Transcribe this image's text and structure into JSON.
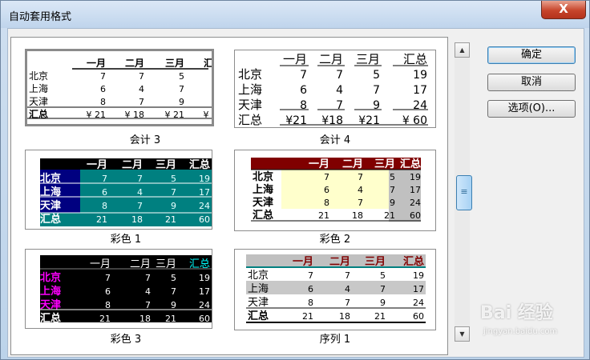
{
  "window": {
    "title": "自动套用格式",
    "close_label": "X"
  },
  "buttons": {
    "ok": "确定",
    "cancel": "取消",
    "options": "选项(O)..."
  },
  "scrollbar": {
    "up": "▲",
    "down": "▼",
    "thumb": "≡"
  },
  "watermark": {
    "brand": "Bai 经验",
    "url": "jingyan.baidu.com"
  },
  "table": {
    "headers": [
      "一月",
      "二月",
      "三月",
      "汇总"
    ],
    "rows": [
      {
        "label": "北京",
        "values": [
          "7",
          "7",
          "5",
          "19"
        ]
      },
      {
        "label": "上海",
        "values": [
          "6",
          "4",
          "7",
          "17"
        ]
      },
      {
        "label": "天津",
        "values": [
          "8",
          "7",
          "9",
          "24"
        ]
      },
      {
        "label": "汇总",
        "values": [
          "21",
          "18",
          "21",
          "60"
        ]
      }
    ],
    "currency_totals": [
      "¥ 21",
      "¥ 18",
      "¥ 21",
      "¥ 60"
    ],
    "currency_totals_tight": [
      "¥21",
      "¥18",
      "¥21",
      "¥ 60"
    ]
  },
  "formats": [
    {
      "id": "accounting3",
      "caption": "会计 3",
      "selected": true
    },
    {
      "id": "accounting4",
      "caption": "会计 4",
      "selected": false
    },
    {
      "id": "colorful1",
      "caption": "彩色 1",
      "selected": false
    },
    {
      "id": "colorful2",
      "caption": "彩色 2",
      "selected": false
    },
    {
      "id": "colorful3",
      "caption": "彩色 3",
      "selected": false
    },
    {
      "id": "list1",
      "caption": "序列 1",
      "selected": false
    }
  ],
  "colors": {
    "teal": "#008080",
    "navy": "#000080",
    "darkred": "#800000",
    "lightyellow": "#ffffcc",
    "gray": "#c0c0c0",
    "magenta": "#ff00ff",
    "cyan": "#00ffff"
  }
}
